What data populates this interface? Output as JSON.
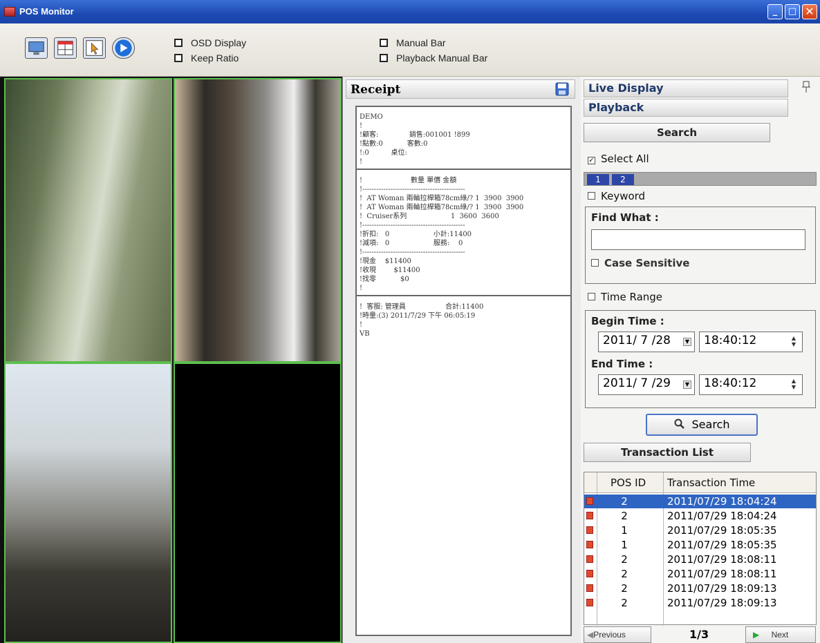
{
  "window": {
    "title": "POS Monitor"
  },
  "toolbar": {
    "icons": [
      "monitor-icon",
      "layout-grid-icon",
      "cursor-icon",
      "play-icon"
    ],
    "options": [
      {
        "label": "OSD Display",
        "checked": false
      },
      {
        "label": "Keep Ratio",
        "checked": false
      },
      {
        "label": "Manual Bar",
        "checked": false
      },
      {
        "label": "Playback Manual Bar",
        "checked": false
      }
    ]
  },
  "receipt": {
    "title": "Receipt",
    "lines": [
      "DEMO",
      "!",
      "!顧客:              銷售:001001 !899",
      "!點數:0           客數:0",
      "!:0          桌位:",
      "!",
      "=",
      "!                      數量 單價 金額",
      "!--------------------------------------------",
      "!  AT Woman 兩輪拉桿箱78cm綠/? 1  3900  3900",
      "!  AT Woman 兩輪拉桿箱78cm綠/? 1  3900  3900",
      "!  Cruiser系列                    1  3600  3600",
      "!--------------------------------------------",
      "!折扣:   0                    小計:11400",
      "!減項:   0                    服務:    0",
      "!--------------------------------------------",
      "!現金    $11400",
      "!收現        $11400",
      "!找零           $0",
      "!",
      "=",
      "!  客服: 管理員                  合計:11400",
      "!時量:(3) 2011/7/29 下午 06:05:19",
      "!",
      "VB"
    ]
  },
  "panel": {
    "live_display": "Live Display",
    "playback": "Playback",
    "search_header": "Search",
    "select_all": "Select All",
    "select_all_checked": true,
    "tabs": [
      "1",
      "2"
    ],
    "keyword": "Keyword",
    "find_what_label": "Find What :",
    "find_what_value": "",
    "case_sensitive": "Case Sensitive",
    "time_range": "Time Range",
    "begin_time_label": "Begin Time :",
    "begin_date": "2011/ 7 /28",
    "begin_time": "18:40:12",
    "end_time_label": "End Time :",
    "end_date": "2011/ 7 /29",
    "end_time": "18:40:12",
    "search_button": "Search",
    "transaction_list": "Transaction List"
  },
  "transactions": {
    "columns": [
      "POS ID",
      "Transaction Time"
    ],
    "rows": [
      {
        "pos": "2",
        "time": "2011/07/29 18:04:24",
        "selected": true
      },
      {
        "pos": "2",
        "time": "2011/07/29 18:04:24",
        "selected": false
      },
      {
        "pos": "1",
        "time": "2011/07/29 18:05:35",
        "selected": false
      },
      {
        "pos": "1",
        "time": "2011/07/29 18:05:35",
        "selected": false
      },
      {
        "pos": "2",
        "time": "2011/07/29 18:08:11",
        "selected": false
      },
      {
        "pos": "2",
        "time": "2011/07/29 18:08:11",
        "selected": false
      },
      {
        "pos": "2",
        "time": "2011/07/29 18:09:13",
        "selected": false
      },
      {
        "pos": "2",
        "time": "2011/07/29 18:09:13",
        "selected": false
      }
    ]
  },
  "pager": {
    "previous": "Previous",
    "page": "1/3",
    "next": "Next"
  },
  "colors": {
    "titlebar": "#1d4bb3",
    "selection": "#2f65c2",
    "camera_border": "#5cbf4f",
    "tab": "#2d47a8"
  }
}
